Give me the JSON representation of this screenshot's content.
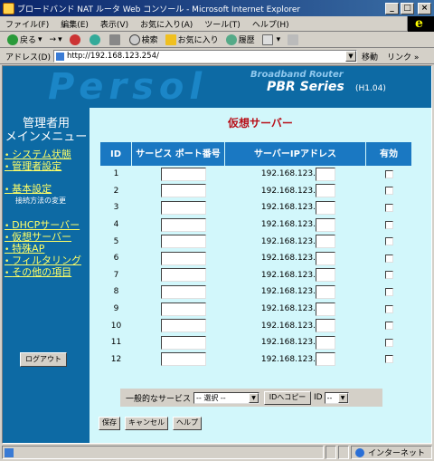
{
  "window": {
    "title": "ブロードバンド NAT ルータ Web コンソール - Microsoft Internet Explorer"
  },
  "menubar": [
    "ファイル(F)",
    "編集(E)",
    "表示(V)",
    "お気に入り(A)",
    "ツール(T)",
    "ヘルプ(H)"
  ],
  "toolbar": {
    "back": "戻る",
    "search": "検索",
    "favorites": "お気に入り",
    "history": "履歴"
  },
  "address": {
    "label": "アドレス(D)",
    "url": "http://192.168.123.254/",
    "go": "移動",
    "links": "リンク »"
  },
  "banner": {
    "logo": "Persol",
    "subtitle": "Broadband Router",
    "series": "PBR Series",
    "version": "(H1.04)"
  },
  "sidebar": {
    "title_line1": "管理者用",
    "title_line2": "メインメニュー",
    "items": [
      {
        "label": "システム状態"
      },
      {
        "label": "管理者設定"
      },
      {
        "label": "基本設定"
      },
      {
        "label": "接続方法の変更"
      },
      {
        "label": "DHCPサーバー"
      },
      {
        "label": "仮想サーバー"
      },
      {
        "label": "特殊AP"
      },
      {
        "label": "フィルタリング"
      },
      {
        "label": "その他の項目"
      }
    ],
    "logout": "ログアウト"
  },
  "main": {
    "title": "仮想サーバー",
    "headers": {
      "id": "ID",
      "port": "サービス ポート番号",
      "ip": "サーバーIPアドレス",
      "enabled": "有効"
    },
    "ip_prefix": "192.168.123.",
    "rows": [
      "1",
      "2",
      "3",
      "4",
      "5",
      "6",
      "7",
      "8",
      "9",
      "10",
      "11",
      "12"
    ],
    "common_services_label": "一般的なサービス",
    "service_select": "-- 選択 --",
    "copy_to_id": "IDへコピー",
    "id_label": "ID",
    "id_select": "--",
    "save": "保存",
    "cancel": "キャンセル",
    "help": "ヘルプ"
  },
  "status": {
    "zone": "インターネット"
  }
}
